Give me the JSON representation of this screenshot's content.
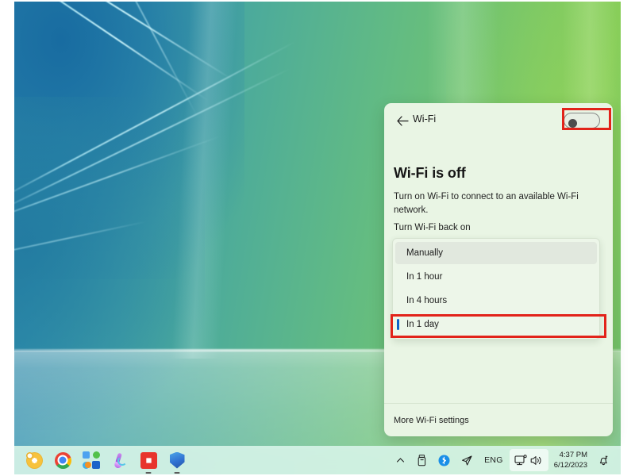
{
  "desktop": {
    "wallpaper_name": "aurora-gradient-wallpaper",
    "colors": {
      "blue": "#2b7fa8",
      "teal": "#4aa99d",
      "green": "#86ce57"
    }
  },
  "panel": {
    "back_icon": "back-arrow-icon",
    "title": "Wi-Fi",
    "toggle": {
      "name": "wifi-toggle",
      "state": "off",
      "aria_label": "Wi-Fi"
    },
    "status_title": "Wi-Fi is off",
    "status_description": "Turn on Wi-Fi to connect to an available Wi-Fi network.",
    "back_on_label": "Turn Wi-Fi back on",
    "dropdown": {
      "name": "turn-wifi-back-on-dropdown",
      "selected": "In 1 day",
      "options": [
        {
          "label": "Manually",
          "state": "current"
        },
        {
          "label": "In 1 hour",
          "state": "normal"
        },
        {
          "label": "In 4 hours",
          "state": "normal"
        },
        {
          "label": "In 1 day",
          "state": "selected"
        }
      ]
    },
    "footer_link": "More Wi-Fi settings"
  },
  "annotations": {
    "accent_color": "#e2231a",
    "boxes": [
      {
        "name": "wifi-toggle-highlight",
        "target": "wifi-toggle"
      },
      {
        "name": "in-1-day-option-highlight",
        "target": "In 1 day"
      }
    ]
  },
  "taskbar": {
    "apps": [
      {
        "name": "chrome-canary-icon",
        "label": "Chrome Canary",
        "running": false
      },
      {
        "name": "google-chrome-icon",
        "label": "Google Chrome",
        "running": false
      },
      {
        "name": "microsoft-store-icon",
        "label": "Microsoft Store",
        "running": false
      },
      {
        "name": "paint-icon",
        "label": "Paint",
        "running": false
      },
      {
        "name": "red-app-icon",
        "label": "App",
        "running": true
      },
      {
        "name": "windows-security-icon",
        "label": "Windows Security",
        "running": true
      }
    ],
    "tray": {
      "overflow_icon": "chevron-up-icon",
      "items": [
        {
          "name": "usb-drive-icon",
          "label": "Safely Remove Hardware"
        },
        {
          "name": "bluetooth-icon",
          "label": "Bluetooth"
        },
        {
          "name": "send-icon",
          "label": "Telegram"
        }
      ],
      "language": "ENG",
      "quick_settings": {
        "name": "quick-settings-button",
        "network_icon": "network-monitor-icon",
        "volume_icon": "volume-icon",
        "active": true
      },
      "clock": {
        "time": "4:37 PM",
        "date": "6/12/2023"
      },
      "notifications_icon": "notification-bell-icon"
    }
  }
}
